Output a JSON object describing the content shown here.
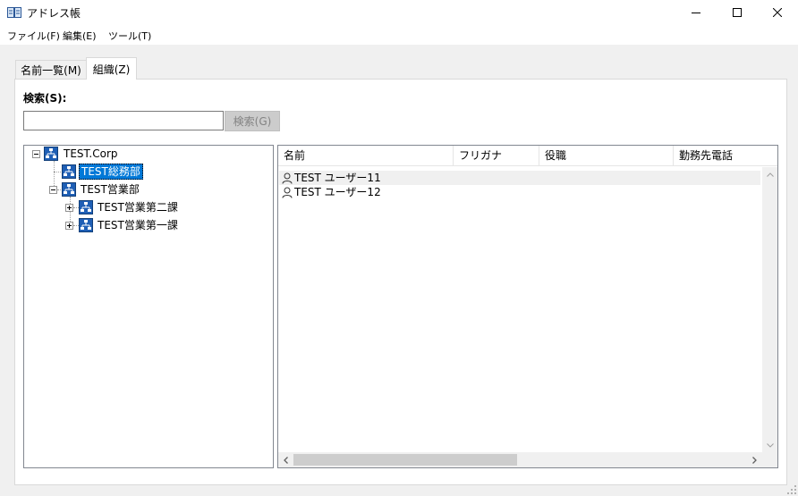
{
  "window": {
    "title": "アドレス帳"
  },
  "menu": {
    "items": [
      "ファイル(F)",
      "編集(E)",
      "ツール(T)"
    ]
  },
  "tabs": [
    {
      "label": "名前一覧(M)",
      "active": false
    },
    {
      "label": "組織(Z)",
      "active": true
    }
  ],
  "search": {
    "label": "検索(S):",
    "value": "",
    "button_label": "検索(G)"
  },
  "tree": {
    "nodes": [
      {
        "label": "TEST.Corp",
        "level": 0,
        "expander": "minus",
        "selected": false
      },
      {
        "label": "TEST総務部",
        "level": 1,
        "expander": "none",
        "selected": true
      },
      {
        "label": "TEST営業部",
        "level": 1,
        "expander": "minus",
        "selected": false
      },
      {
        "label": "TEST営業第二課",
        "level": 2,
        "expander": "plus",
        "selected": false
      },
      {
        "label": "TEST営業第一課",
        "level": 2,
        "expander": "plus",
        "selected": false
      }
    ]
  },
  "list": {
    "columns": [
      "名前",
      "フリガナ",
      "役職",
      "勤務先電話"
    ],
    "rows": [
      {
        "name": "TEST ユーザー11",
        "icon": "user-icon"
      },
      {
        "name": "TEST ユーザー12",
        "icon": "user-icon"
      }
    ]
  },
  "colors": {
    "selection": "#0078d7",
    "client_bg": "#f0f0f0",
    "border": "#828790"
  }
}
